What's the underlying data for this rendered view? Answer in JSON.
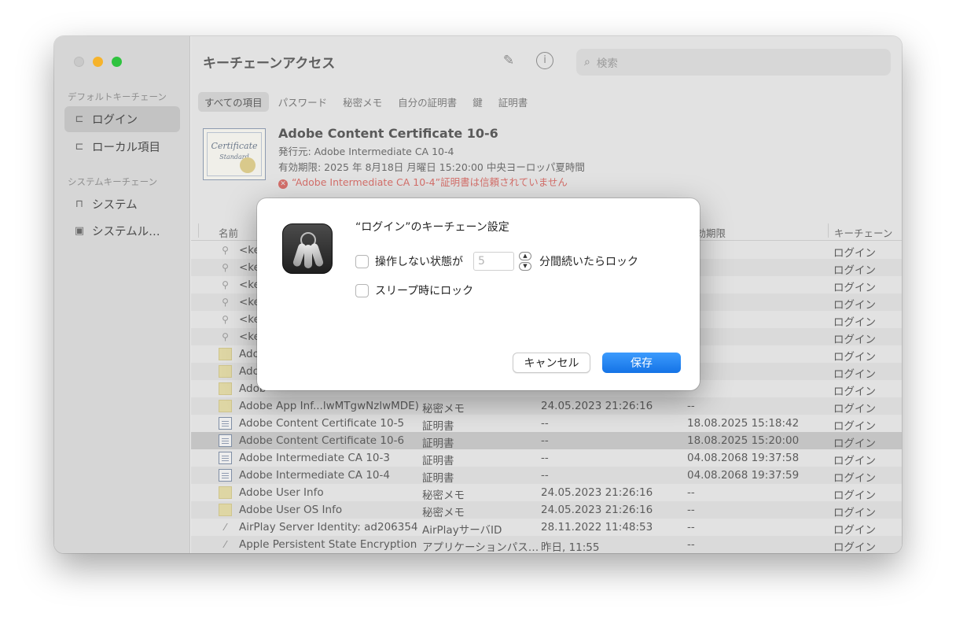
{
  "app_title": "キーチェーンアクセス",
  "search": {
    "placeholder": "検索"
  },
  "sidebar": {
    "default_header": "デフォルトキーチェーン",
    "system_header": "システムキーチェーン",
    "items": [
      {
        "label": "ログイン",
        "icon": "unlock-icon",
        "selected": true
      },
      {
        "label": "ローカル項目",
        "icon": "unlock-icon"
      },
      {
        "label": "システム",
        "icon": "lock-icon"
      },
      {
        "label": "システムル…",
        "icon": "vault-icon"
      }
    ]
  },
  "tabs": [
    "すべての項目",
    "パスワード",
    "秘密メモ",
    "自分の証明書",
    "鍵",
    "証明書"
  ],
  "cert": {
    "name": "Adobe Content Certificate 10-6",
    "issuer": "発行元: Adobe Intermediate CA 10-4",
    "expires": "有効期限: 2025 年 8月18日 月曜日 15:20:00 中央ヨーロッパ夏時間",
    "error": "“Adobe Intermediate CA 10-4”証明書は信頼されていません",
    "image_text": "Certificate",
    "image_subtext": "Standard"
  },
  "columns": {
    "name": "名前",
    "expires": "有効期限",
    "keychain": "キーチェーン"
  },
  "rows": [
    {
      "name": "<ke",
      "icon": "key",
      "kind": "",
      "modified": "",
      "expires": "",
      "keychain": "ログイン"
    },
    {
      "name": "<ke",
      "icon": "key",
      "kind": "",
      "modified": "",
      "expires": "",
      "keychain": "ログイン"
    },
    {
      "name": "<ke",
      "icon": "key",
      "kind": "",
      "modified": "",
      "expires": "",
      "keychain": "ログイン"
    },
    {
      "name": "<ke",
      "icon": "key",
      "kind": "",
      "modified": "",
      "expires": "",
      "keychain": "ログイン"
    },
    {
      "name": "<ke",
      "icon": "key",
      "kind": "",
      "modified": "",
      "expires": "",
      "keychain": "ログイン"
    },
    {
      "name": "<ke",
      "icon": "key",
      "kind": "",
      "modified": "",
      "expires": "",
      "keychain": "ログイン"
    },
    {
      "name": "Adob",
      "icon": "note",
      "kind": "",
      "modified": "",
      "expires": "",
      "keychain": "ログイン"
    },
    {
      "name": "Adob",
      "icon": "note",
      "kind": "",
      "modified": "",
      "expires": "",
      "keychain": "ログイン"
    },
    {
      "name": "Adob",
      "icon": "note",
      "kind": "",
      "modified": "",
      "expires": "",
      "keychain": "ログイン"
    },
    {
      "name": "Adobe App Inf...lwMTgwNzlwMDE)",
      "icon": "note",
      "kind": "秘密メモ",
      "modified": "24.05.2023 21:26:16",
      "expires": "--",
      "keychain": "ログイン"
    },
    {
      "name": "Adobe Content Certificate 10-5",
      "icon": "cert",
      "kind": "証明書",
      "modified": "--",
      "expires": "18.08.2025 15:18:42",
      "keychain": "ログイン"
    },
    {
      "name": "Adobe Content Certificate 10-6",
      "icon": "cert",
      "kind": "証明書",
      "modified": "--",
      "expires": "18.08.2025 15:20:00",
      "keychain": "ログイン",
      "selected": true
    },
    {
      "name": "Adobe Intermediate CA 10-3",
      "icon": "cert",
      "kind": "証明書",
      "modified": "--",
      "expires": "04.08.2068 19:37:58",
      "keychain": "ログイン"
    },
    {
      "name": "Adobe Intermediate CA 10-4",
      "icon": "cert",
      "kind": "証明書",
      "modified": "--",
      "expires": "04.08.2068 19:37:59",
      "keychain": "ログイン"
    },
    {
      "name": "Adobe User Info",
      "icon": "note",
      "kind": "秘密メモ",
      "modified": "24.05.2023 21:26:16",
      "expires": "--",
      "keychain": "ログイン"
    },
    {
      "name": "Adobe User OS Info",
      "icon": "note",
      "kind": "秘密メモ",
      "modified": "24.05.2023 21:26:16",
      "expires": "--",
      "keychain": "ログイン"
    },
    {
      "name": "AirPlay Server Identity: ad206354",
      "icon": "app",
      "kind": "AirPlayサーバID",
      "modified": "28.11.2022 11:48:53",
      "expires": "--",
      "keychain": "ログイン"
    },
    {
      "name": "Apple Persistent State Encryption",
      "icon": "app",
      "kind": "アプリケーションパス…",
      "modified": "昨日, 11:55",
      "expires": "--",
      "keychain": "ログイン"
    }
  ],
  "dialog": {
    "title": "“ログイン”のキーチェーン設定",
    "idle_lock_prefix": "操作しない状態が",
    "idle_minutes": "5",
    "idle_lock_suffix": "分間続いたらロック",
    "sleep_lock": "スリープ時にロック",
    "cancel": "キャンセル",
    "save": "保存"
  }
}
